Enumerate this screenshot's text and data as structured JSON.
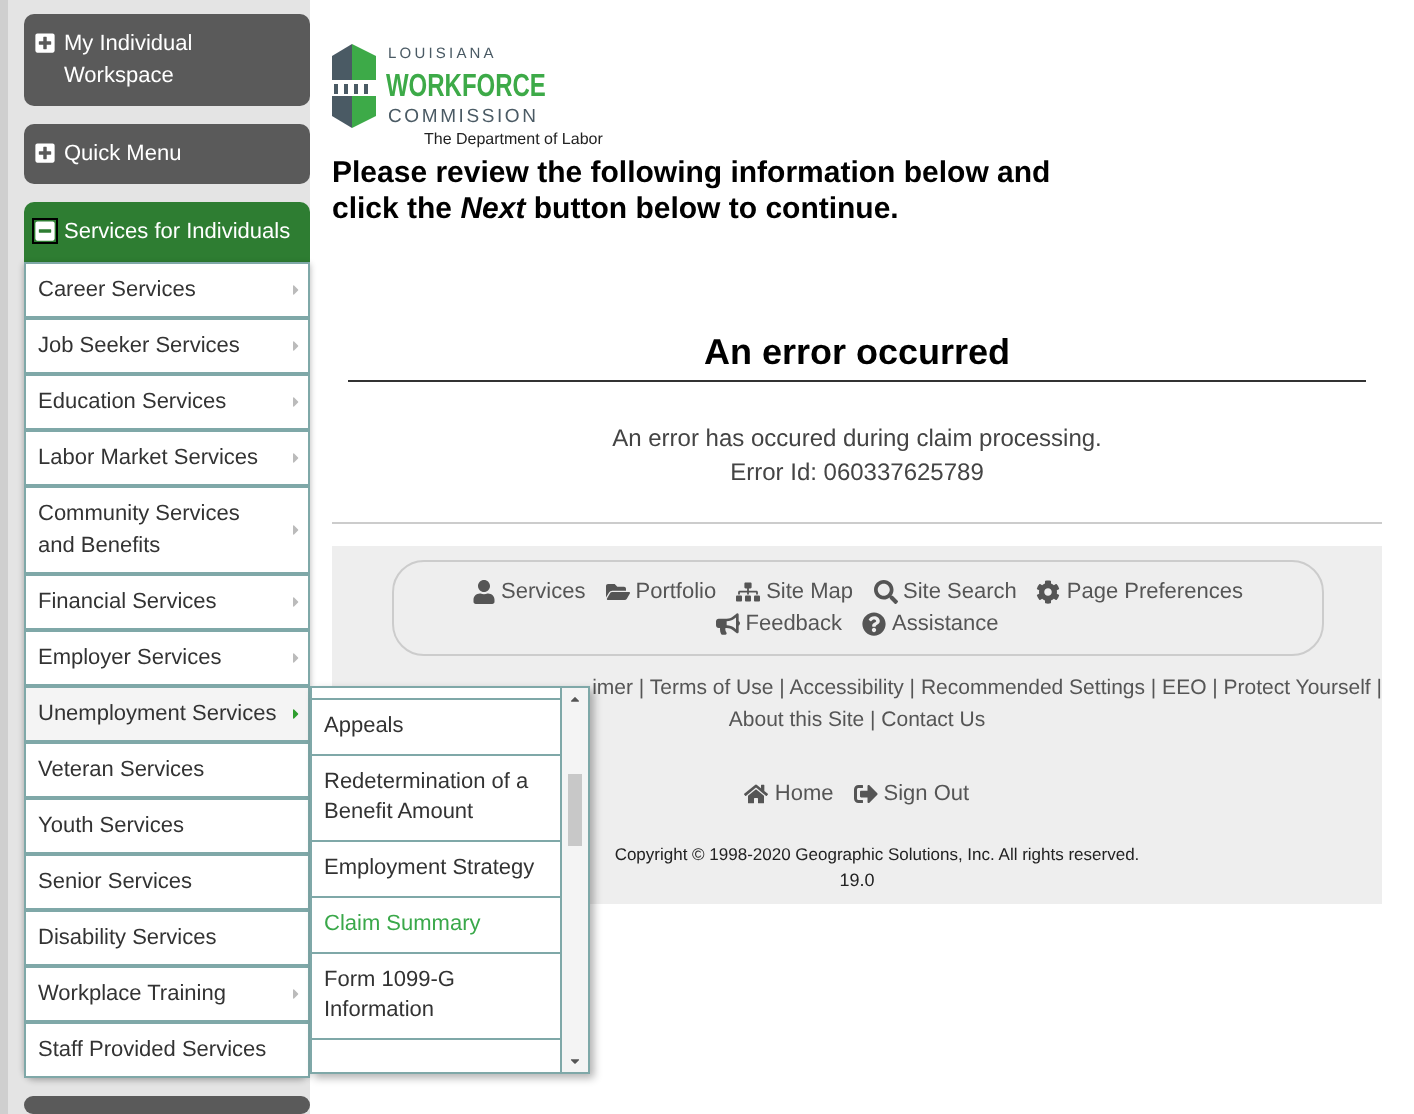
{
  "sidebar": {
    "panels": [
      {
        "label": "My Individual Workspace",
        "expanded": false
      },
      {
        "label": "Quick Menu",
        "expanded": false
      },
      {
        "label": "Services for Individuals",
        "expanded": true,
        "items": [
          {
            "label": "Career Services",
            "has_submenu": true,
            "selected": false
          },
          {
            "label": "Job Seeker Services",
            "has_submenu": true,
            "selected": false
          },
          {
            "label": "Education Services",
            "has_submenu": true,
            "selected": false
          },
          {
            "label": "Labor Market Services",
            "has_submenu": true,
            "selected": false
          },
          {
            "label": "Community Services and Benefits",
            "has_submenu": true,
            "selected": false
          },
          {
            "label": "Financial Services",
            "has_submenu": true,
            "selected": false
          },
          {
            "label": "Employer Services",
            "has_submenu": true,
            "selected": false
          },
          {
            "label": "Unemployment Services",
            "has_submenu": true,
            "selected": true
          },
          {
            "label": "Veteran Services",
            "has_submenu": false,
            "selected": false
          },
          {
            "label": "Youth Services",
            "has_submenu": false,
            "selected": false
          },
          {
            "label": "Senior Services",
            "has_submenu": false,
            "selected": false
          },
          {
            "label": "Disability Services",
            "has_submenu": false,
            "selected": false
          },
          {
            "label": "Workplace Training",
            "has_submenu": true,
            "selected": false
          },
          {
            "label": "Staff Provided Services",
            "has_submenu": false,
            "selected": false
          }
        ]
      }
    ]
  },
  "submenu": {
    "items": [
      {
        "label": "Appeals",
        "selected": false
      },
      {
        "label": "Redetermination of a Benefit Amount",
        "selected": false
      },
      {
        "label": "Employment Strategy",
        "selected": false
      },
      {
        "label": "Claim Summary",
        "selected": true
      },
      {
        "label": "Form 1099-G Information",
        "selected": false
      }
    ]
  },
  "logo": {
    "line_1": "LOUISIANA",
    "line_2": "WORKFORCE",
    "line_3": "COMMISSION",
    "tagline": "The Department of Labor"
  },
  "instructions": "Please review the following information below and click the *Next* button below to continue.",
  "error": {
    "title": "An error occurred",
    "message": "An error has occured during claim processing.",
    "error_id": "Error Id: 060337625789"
  },
  "footer": {
    "nav": [
      {
        "label": "Services"
      },
      {
        "label": "Portfolio"
      },
      {
        "label": "Site Map"
      },
      {
        "label": "Site Search"
      },
      {
        "label": "Page Preferences"
      },
      {
        "label": "Feedback"
      },
      {
        "label": "Assistance"
      }
    ],
    "links_line_1": "imer | Terms of Use | Accessibility | Recommended Settings | EEO | Protect Yourself |",
    "links_line_2": "About this Site | Contact Us",
    "actions": [
      {
        "label": "Home"
      },
      {
        "label": "Sign Out"
      }
    ],
    "copyright": "Copyright © 1998-2020 Geographic Solutions, Inc. All rights reserved.",
    "version": "19.0"
  }
}
